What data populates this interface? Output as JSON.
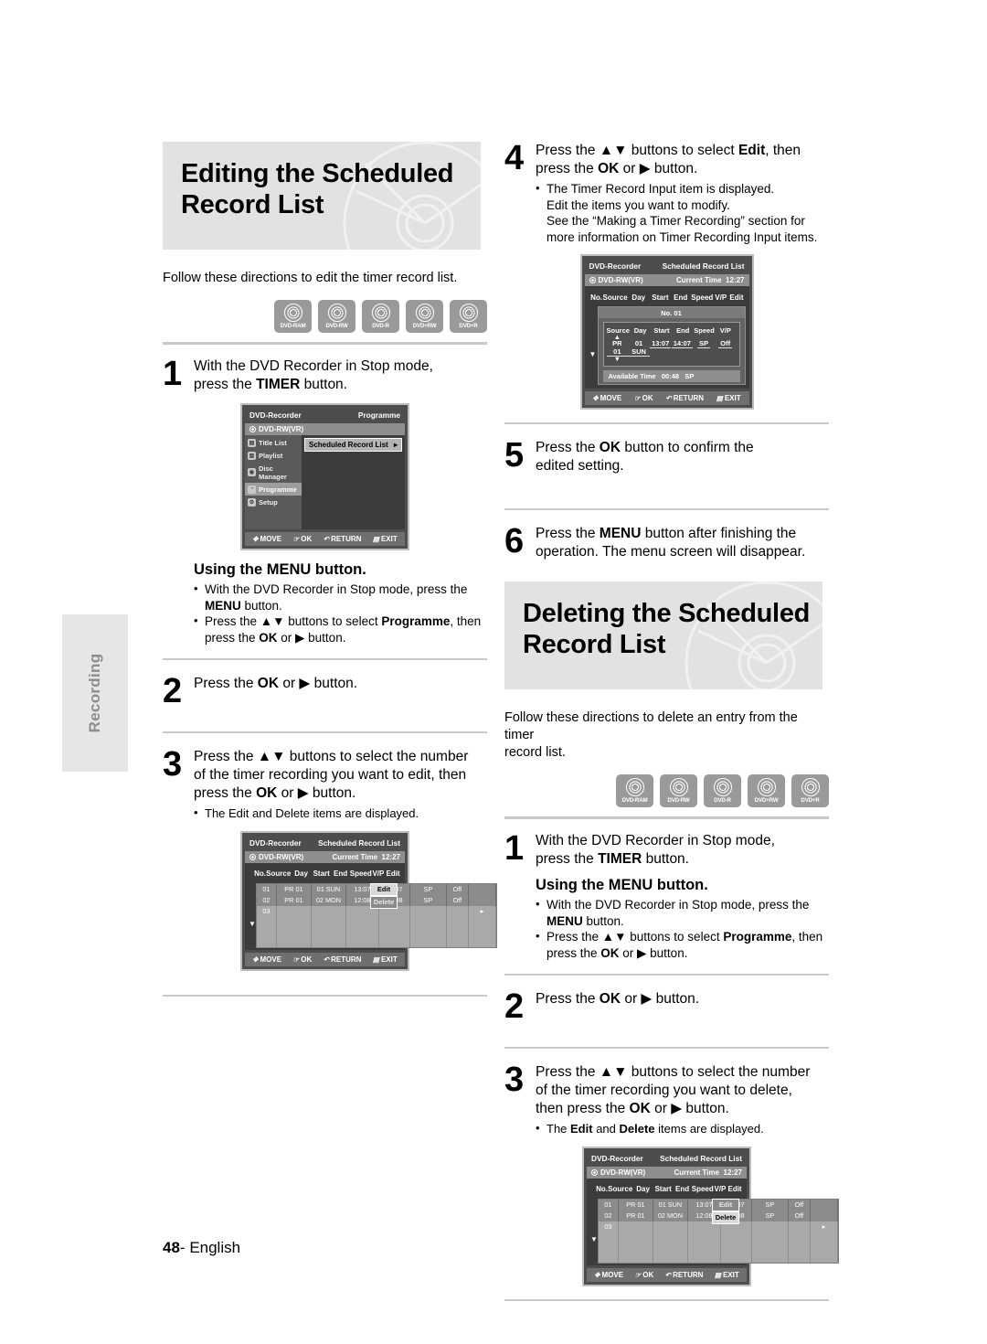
{
  "page": {
    "number": "48",
    "language": "English",
    "side_tab": "Recording"
  },
  "sections": {
    "editing": {
      "title_line1": "Editing the Scheduled",
      "title_line2": "Record List",
      "lead": "Follow these directions to edit the timer record list.",
      "media": [
        "DVD-RAM",
        "DVD-RW",
        "DVD-R",
        "DVD+RW",
        "DVD+R"
      ],
      "step1": {
        "num": "1",
        "line1": "With the DVD Recorder in Stop mode,",
        "line2_pre": "press the ",
        "line2_bold": "TIMER",
        "line2_post": " button."
      },
      "menu_note": {
        "heading": "Using the MENU button.",
        "b1_pre": "With the DVD Recorder in Stop mode, press the ",
        "b1_bold": "MENU",
        "b1_post": " button.",
        "b2_pre": "Press the ",
        "b2_arrows": "▲▼",
        "b2_mid": " buttons to select ",
        "b2_bold": "Programme",
        "b2_post": ", then",
        "b2_cont_pre": "press the ",
        "b2_cont_bold": "OK",
        "b2_cont_mid": " or  ▶ button."
      },
      "step2": {
        "num": "2",
        "pre": "Press the ",
        "bold": "OK",
        "post": " or ▶ button."
      },
      "step3": {
        "num": "3",
        "line1_pre": "Press the ",
        "line1_arrows": "▲▼",
        "line1_post": " buttons to select the number",
        "line2": "of the timer recording you want to edit, then",
        "line3_pre": "press the ",
        "line3_bold": "OK",
        "line3_post": " or ▶ button.",
        "bullet": "The Edit and Delete items are displayed."
      }
    },
    "editing_right": {
      "step4": {
        "num": "4",
        "line1_pre": "Press the ",
        "line1_arrows": "▲▼",
        "line1_mid": " buttons to select ",
        "line1_bold": "Edit",
        "line1_post": ", then",
        "line2_pre": "press the ",
        "line2_bold": "OK",
        "line2_post": " or ▶ button.",
        "bullet_l1": "The Timer Record Input item is displayed.",
        "bullet_l2": "Edit the items you want to modify.",
        "bullet_l3": "See the “Making a Timer Recording” section for",
        "bullet_l4": "more information on Timer Recording Input items."
      },
      "step5": {
        "num": "5",
        "line1_pre": "Press the ",
        "line1_bold": "OK",
        "line1_post": " button to confirm the",
        "line2": "edited setting."
      },
      "step6": {
        "num": "6",
        "line1_pre": "Press the ",
        "line1_bold": "MENU",
        "line1_post": " button after finishing the",
        "line2": "operation. The menu screen will disappear."
      }
    },
    "deleting": {
      "title_line1": "Deleting the Scheduled",
      "title_line2": "Record List",
      "lead_l1": "Follow these directions to delete an entry from the timer",
      "lead_l2": "record list.",
      "media": [
        "DVD-RAM",
        "DVD-RW",
        "DVD-R",
        "DVD+RW",
        "DVD+R"
      ],
      "step1": {
        "num": "1",
        "line1": "With the DVD Recorder in Stop mode,",
        "line2_pre": "press the ",
        "line2_bold": "TIMER",
        "line2_post": " button."
      },
      "menu_note": {
        "heading": "Using the MENU button.",
        "b1_pre": "With the DVD Recorder in Stop mode, press the ",
        "b1_bold": "MENU",
        "b1_post": " button.",
        "b2_pre": "Press the ",
        "b2_arrows": "▲▼",
        "b2_mid": " buttons to select ",
        "b2_bold": "Programme",
        "b2_post": ", then",
        "b2_cont_pre": "press the ",
        "b2_cont_bold": "OK",
        "b2_cont_mid": " or  ▶ button."
      },
      "step2": {
        "num": "2",
        "pre": "Press the ",
        "bold": "OK",
        "post": " or ▶ button."
      },
      "step3": {
        "num": "3",
        "line1_pre": "Press the ",
        "line1_arrows": "▲▼",
        "line1_post": " buttons to select the number",
        "line2": "of the timer recording you want to delete,",
        "line3_pre": "then press the ",
        "line3_bold": "OK",
        "line3_post": " or ▶ button.",
        "bullet_pre": "The ",
        "bullet_b1": "Edit",
        "bullet_mid": " and ",
        "bullet_b2": "Delete",
        "bullet_post": " items are displayed."
      }
    }
  },
  "osd": {
    "common": {
      "brand": "DVD-Recorder",
      "disc_label": "DVD-RW(VR)",
      "nav": [
        {
          "icon": "✥",
          "label": "MOVE"
        },
        {
          "icon": "☞",
          "label": "OK"
        },
        {
          "icon": "↶",
          "label": "RETURN"
        },
        {
          "icon": "▤",
          "label": "EXIT"
        }
      ]
    },
    "programme_menu": {
      "title": "Programme",
      "sidebar": [
        {
          "label": "Title List",
          "icon": "▤",
          "selected": false
        },
        {
          "label": "Playlist",
          "icon": "▥",
          "selected": false
        },
        {
          "label": "Disc Manager",
          "icon": "◉",
          "selected": false
        },
        {
          "label": "Programme",
          "icon": "◔",
          "selected": true
        },
        {
          "label": "Setup",
          "icon": "⚙",
          "selected": false
        }
      ],
      "entry": "Scheduled Record List",
      "entry_arrow": "▸"
    },
    "scheduled_list": {
      "title": "Scheduled Record List",
      "current_time_label": "Current Time",
      "current_time": "12:27",
      "columns": [
        "No.",
        "Source",
        "Day",
        "Start",
        "End",
        "Speed",
        "V/P",
        "Edit"
      ],
      "rows": [
        {
          "no": "01",
          "source": "PR 01",
          "day": "01 SUN",
          "start": "13:07",
          "end": "14:07",
          "speed": "SP",
          "vp": "Off",
          "edit": ""
        },
        {
          "no": "02",
          "source": "PR 01",
          "day": "02 MON",
          "start": "12:08",
          "end": "14:08",
          "speed": "SP",
          "vp": "Off",
          "edit": ""
        },
        {
          "no": "03",
          "source": "",
          "day": "",
          "start": "",
          "end": "",
          "speed": "",
          "vp": "",
          "edit": "▸"
        }
      ],
      "empty_rows": 3,
      "popup_edit": "Edit",
      "popup_delete": "Delete",
      "scroll_arrow": "▼"
    },
    "timer_input": {
      "title": "Scheduled Record List",
      "current_time_label": "Current Time",
      "current_time": "12:27",
      "columns": [
        "No.",
        "Source",
        "Day",
        "Start",
        "End",
        "Speed",
        "V/P",
        "Edit"
      ],
      "no_label": "No. 01",
      "field_headers": [
        "Source",
        "Day",
        "Start",
        "End",
        "Speed",
        "V/P"
      ],
      "field_values": [
        "PR 01",
        "01 SUN",
        "13:07",
        "14:07",
        "SP",
        "Off"
      ],
      "available_label": "Available Time",
      "available_time": "00:48",
      "available_speed": "SP",
      "scroll_arrow": "▼",
      "caret_up": "▲",
      "caret_down": "▼"
    }
  }
}
